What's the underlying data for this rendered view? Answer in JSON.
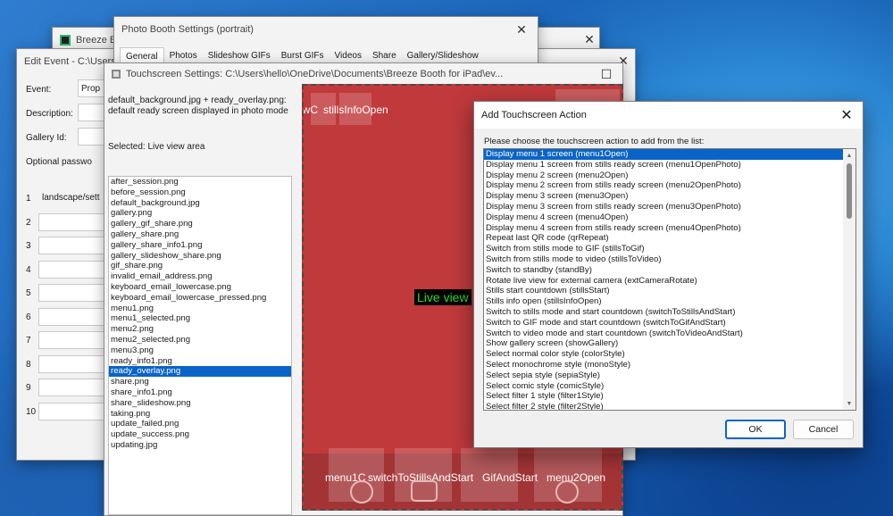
{
  "windows": {
    "breeze": {
      "title": "Breeze Boo"
    },
    "photo_booth": {
      "title": "Photo Booth Settings (portrait)",
      "tabs": [
        "General",
        "Photos",
        "Slideshow GIFs",
        "Burst GIFs",
        "Videos",
        "Share",
        "Gallery/Slideshow"
      ],
      "active_tab": "General"
    },
    "edit_event": {
      "title": "Edit Event - C:\\Users",
      "labels": {
        "event": "Event:",
        "event_value": "Prop",
        "description": "Description:",
        "gallery_id": "Gallery Id:",
        "optional_password": "Optional passwo"
      },
      "rows": [
        {
          "num": "1",
          "value": "landscape/sett"
        },
        {
          "num": "2",
          "value": ""
        },
        {
          "num": "3",
          "value": ""
        },
        {
          "num": "4",
          "value": ""
        },
        {
          "num": "5",
          "value": ""
        },
        {
          "num": "6",
          "value": ""
        },
        {
          "num": "7",
          "value": ""
        },
        {
          "num": "8",
          "value": ""
        },
        {
          "num": "9",
          "value": ""
        },
        {
          "num": "10",
          "value": ""
        }
      ]
    },
    "touchscreen": {
      "title": "Touchscreen Settings: C:\\Users\\hello\\OneDrive\\Documents\\Breeze Booth for iPad\\ev...",
      "description_line1": "default_background.jpg + ready_overlay.png:",
      "description_line2": "default ready screen displayed in photo mode",
      "selected_text": "Selected: Live view area",
      "files": [
        "after_session.png",
        "before_session.png",
        "default_background.jpg",
        "gallery.png",
        "gallery_gif_share.png",
        "gallery_share.png",
        "gallery_share_info1.png",
        "gallery_slideshow_share.png",
        "gif_share.png",
        "invalid_email_address.png",
        "keyboard_email_lowercase.png",
        "keyboard_email_lowercase_pressed.png",
        "menu1.png",
        "menu1_selected.png",
        "menu2.png",
        "menu2_selected.png",
        "menu3.png",
        "ready_info1.png",
        "ready_overlay.png",
        "share.png",
        "share_info1.png",
        "share_slideshow.png",
        "taking.png",
        "update_failed.png",
        "update_success.png",
        "updating.jpg"
      ],
      "selected_file": "ready_overlay.png",
      "preview": {
        "top_label_left": "owC",
        "top_label": "stillsInfoOpen",
        "live_view": "Live view",
        "bottom_labels": [
          "menu1C",
          "switchToStillsAndStart",
          "GifAndStart",
          "menu2Open"
        ]
      }
    },
    "add_action": {
      "title": "Add Touchscreen Action",
      "prompt": "Please choose the touchscreen action to add from the list:",
      "actions": [
        "Display menu 1 screen (menu1Open)",
        "Display menu 1 screen from stills ready screen (menu1OpenPhoto)",
        "Display menu 2 screen (menu2Open)",
        "Display menu 2 screen from stills ready screen (menu2OpenPhoto)",
        "Display menu 3 screen (menu3Open)",
        "Display menu 3 screen from stills ready screen (menu3OpenPhoto)",
        "Display menu 4 screen (menu4Open)",
        "Display menu 4 screen from stills ready screen (menu4OpenPhoto)",
        "Repeat last QR code (qrRepeat)",
        "Switch from stills mode to GIF (stillsToGif)",
        "Switch from stills mode to video (stillsToVideo)",
        "Switch to standby (standBy)",
        "Rotate live view for external camera (extCameraRotate)",
        "Stills start countdown (stillsStart)",
        "Stills info open (stillsInfoOpen)",
        "Switch to stills mode and start countdown (switchToStillsAndStart)",
        "Switch to GIF mode and start countdown (switchToGifAndStart)",
        "Switch to video mode and start countdown (switchToVideoAndStart)",
        "Show gallery screen (showGallery)",
        "Select normal color style (colorStyle)",
        "Select monochrome style (monoStyle)",
        "Select sepia style (sepiaStyle)",
        "Select comic style (comicStyle)",
        "Select filter 1 style (filter1Style)",
        "Select filter 2 style (filter2Style)"
      ],
      "selected_index": 0,
      "ok_label": "OK",
      "cancel_label": "Cancel"
    }
  },
  "colors": {
    "accent": "#0a64c8",
    "preview_red": "#c0393b",
    "live_view_bg": "#000000",
    "live_view_text": "#2bdc2b"
  }
}
